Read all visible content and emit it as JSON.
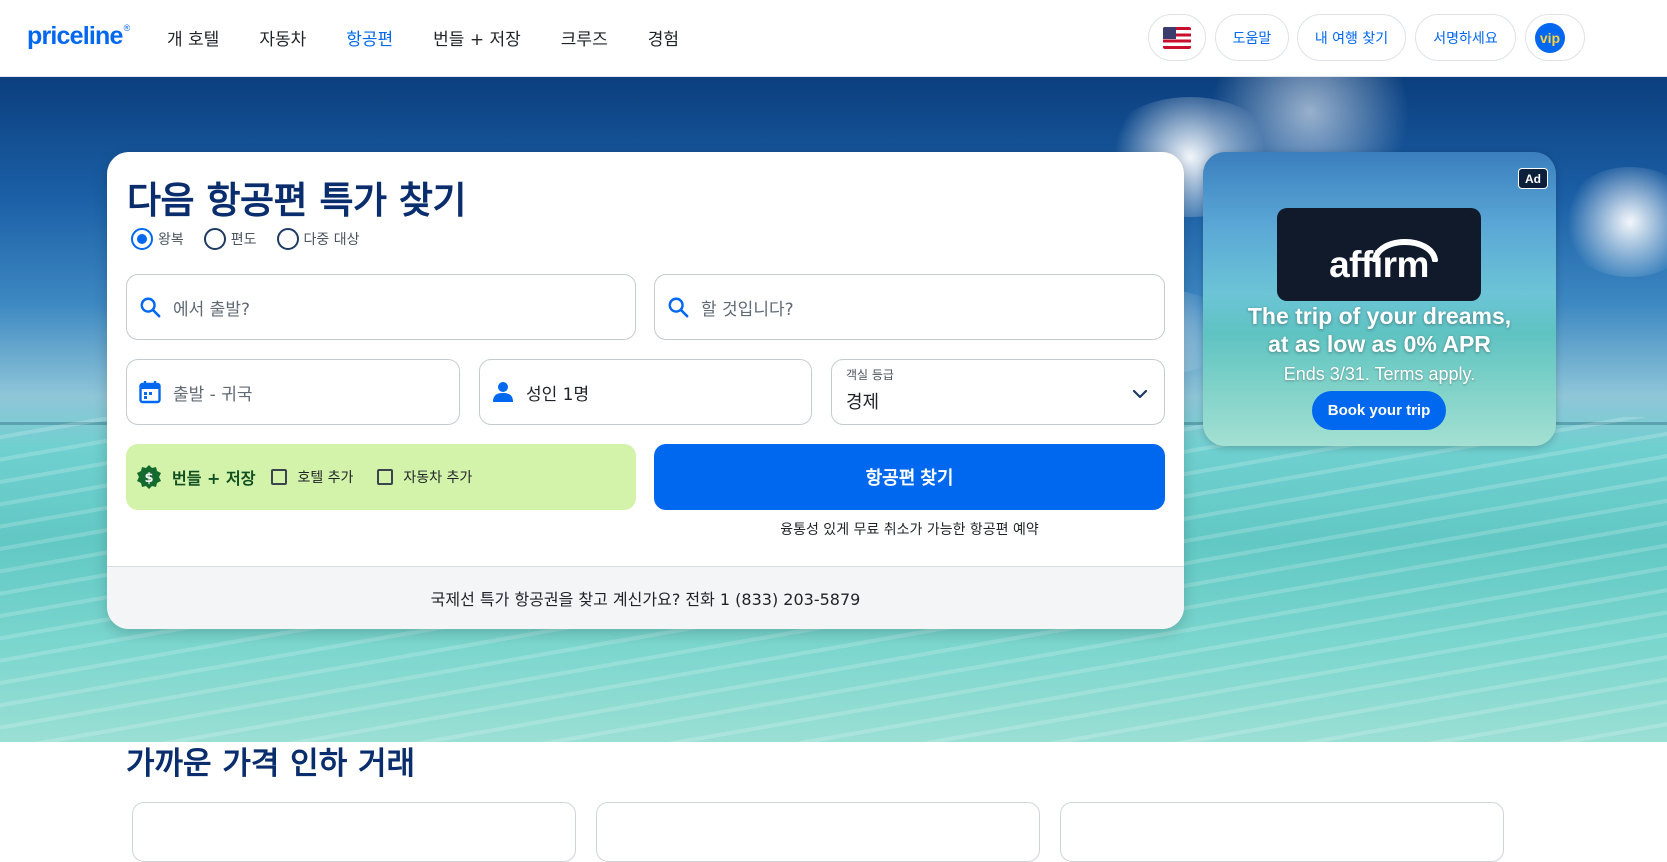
{
  "header": {
    "logo_text": "priceline",
    "logo_mark": "®",
    "nav": [
      {
        "label": "개 호텔",
        "active": false
      },
      {
        "label": "자동차",
        "active": false
      },
      {
        "label": "항공편",
        "active": true
      },
      {
        "label": "번들 + 저장",
        "active": false
      },
      {
        "label": "크루즈",
        "active": false
      },
      {
        "label": "경험",
        "active": false
      }
    ],
    "language_icon": "us-flag-icon",
    "help_label": "도움말",
    "trips_label": "내 여행 찾기",
    "signin_label": "서명하세요",
    "vip_label": "vip"
  },
  "search": {
    "title": "다음 항공편 특가 찾기",
    "trip_types": [
      {
        "label": "왕복",
        "selected": true
      },
      {
        "label": "편도",
        "selected": false
      },
      {
        "label": "다중 대상",
        "selected": false
      }
    ],
    "origin_placeholder": "에서 출발?",
    "destination_placeholder": "할 것입니다?",
    "dates_placeholder": "출발 - 귀국",
    "travelers_value": "성인 1명",
    "cabin_label": "객실 등급",
    "cabin_value": "경제",
    "bundle_title": "번들 + 저장",
    "add_hotel_label": "호텔 추가",
    "add_car_label": "자동차 추가",
    "search_button_label": "항공편 찾기",
    "flex_note": "융통성 있게 무료 취소가 가능한 항공편 예약",
    "footer_text": "국제선 특가 항공권을 찾고 계신가요? 전화 1 (833) 203-5879"
  },
  "ad": {
    "tag": "Ad",
    "brand": "affirm",
    "headline_1": "The trip of your dreams,",
    "headline_2": "at as low as 0% APR",
    "subline": "Ends 3/31. Terms apply.",
    "button_label": "Book your trip"
  },
  "deals": {
    "title": "가까운 가격 인하 거래"
  },
  "colors": {
    "brand_blue": "#0068ef",
    "title_navy": "#0a2d6e",
    "bundle_green": "#d3f2aa"
  }
}
